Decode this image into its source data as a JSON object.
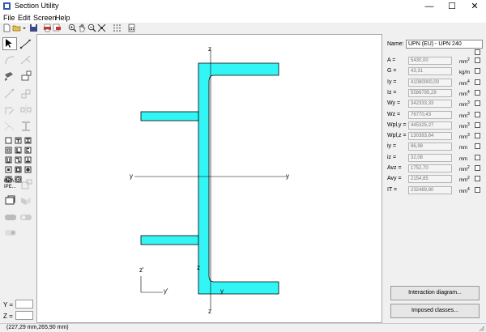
{
  "window": {
    "title": "Section Utility",
    "minimize": "—",
    "maximize": "☐",
    "close": "✕"
  },
  "menu": [
    {
      "label": "File"
    },
    {
      "label": "Edit"
    },
    {
      "label": "Screen"
    },
    {
      "label": "Help"
    }
  ],
  "toolbar": {
    "icons": [
      "new-file-icon",
      "open-folder-icon",
      "save-icon",
      "print-icon",
      "print-preview-icon",
      "zoom-in-icon",
      "pan-hand-icon",
      "zoom-out-icon",
      "zoom-extents-icon",
      "grid-icon",
      "calculator-icon"
    ]
  },
  "left_panel": {
    "tools": [
      "select-arrow-icon",
      "line-tool-icon",
      "arc-tool-icon",
      "dim-tool-icon",
      "paint-icon",
      "fill-icon",
      "node-icon",
      "move-icon",
      "rotate-icon",
      "mirror-icon",
      "scale-icon",
      "stretch-icon"
    ],
    "hea_label": "HEA",
    "ipe_label": "IPE...",
    "y_label": "Y =",
    "z_label": "Z =",
    "y_value": "",
    "z_value": ""
  },
  "canvas": {
    "axis_labels": {
      "z_top": "z",
      "z_bottom": "z",
      "y_left": "y",
      "y_right": "y",
      "z_inner": "z",
      "y_inner": "y",
      "z_prime": "z'",
      "y_prime": "y'"
    },
    "shape_color": "#33f5f5",
    "axis_color": "#000000"
  },
  "properties": {
    "name_label": "Name:",
    "name_value": "UPN (EU) - UPN 240",
    "rows": [
      {
        "label": "A =",
        "value": "5430,00",
        "unit": "mm",
        "sup": "2"
      },
      {
        "label": "G =",
        "value": "43,31",
        "unit": "kg/m",
        "sup": ""
      },
      {
        "label": "Iy =",
        "value": "41080000,00",
        "unit": "mm",
        "sup": "4"
      },
      {
        "label": "Iz =",
        "value": "5586795,29",
        "unit": "mm",
        "sup": "4"
      },
      {
        "label": "Wy =",
        "value": "342333,33",
        "unit": "mm",
        "sup": "3"
      },
      {
        "label": "Wz =",
        "value": "76770,43",
        "unit": "mm",
        "sup": "3"
      },
      {
        "label": "Wpl,y =",
        "value": "445325,27",
        "unit": "mm",
        "sup": "3"
      },
      {
        "label": "Wpl,z =",
        "value": "130383,64",
        "unit": "mm",
        "sup": "3"
      },
      {
        "label": "iy =",
        "value": "86,98",
        "unit": "mm",
        "sup": ""
      },
      {
        "label": "iz =",
        "value": "32,08",
        "unit": "mm",
        "sup": ""
      },
      {
        "label": "Avz =",
        "value": "1752,70",
        "unit": "mm",
        "sup": "2"
      },
      {
        "label": "Avy =",
        "value": "2154,85",
        "unit": "mm",
        "sup": "2"
      },
      {
        "label": "IT =",
        "value": "232489,80",
        "unit": "mm",
        "sup": "4"
      }
    ],
    "interaction_button": "Interaction diagram...",
    "classes_button": "Imposed classes..."
  },
  "status": {
    "coords": "(227,29 mm,265,90 mm)"
  }
}
